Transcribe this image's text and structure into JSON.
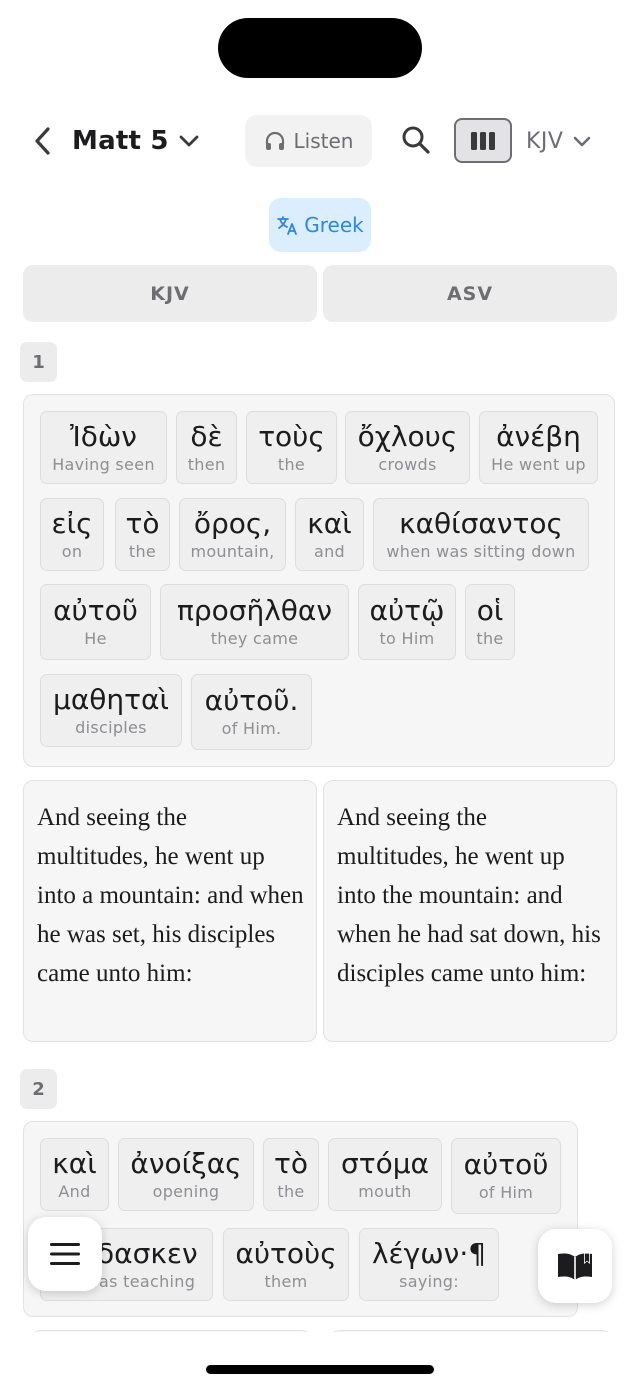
{
  "header": {
    "book_chapter": "Matt 5",
    "listen_label": "Listen",
    "version": "KJV",
    "icons": [
      "chevron-left-icon",
      "chevron-down-icon",
      "headphones-icon",
      "search-icon",
      "columns-icon"
    ]
  },
  "language_toggle": {
    "label": "Greek",
    "icon": "translate-icon",
    "accent": "#2e86de"
  },
  "version_tabs": [
    "KJV",
    "ASV"
  ],
  "verses": [
    {
      "number": "1",
      "words": [
        {
          "greek": "Ἰδὼν",
          "english": "Having seen"
        },
        {
          "greek": "δὲ",
          "english": "then"
        },
        {
          "greek": "τοὺς",
          "english": "the"
        },
        {
          "greek": "ὄχλους",
          "english": "crowds"
        },
        {
          "greek": "ἀνέβη",
          "english": "He went up"
        },
        {
          "greek": "εἰς",
          "english": "on"
        },
        {
          "greek": "τὸ",
          "english": "the"
        },
        {
          "greek": "ὄρος,",
          "english": "mountain,"
        },
        {
          "greek": "καὶ",
          "english": "and"
        },
        {
          "greek": "καθίσαντος",
          "english": "when was sitting down"
        },
        {
          "greek": "αὐτοῦ",
          "english": "He"
        },
        {
          "greek": "προσῆλθαν",
          "english": "they came"
        },
        {
          "greek": "αὐτῷ",
          "english": "to Him"
        },
        {
          "greek": "οἱ",
          "english": "the"
        },
        {
          "greek": "μαθηταὶ",
          "english": "disciples"
        },
        {
          "greek": "αὐτοῦ.",
          "english": "of Him."
        }
      ],
      "translations": [
        "And seeing the multitudes, he went up into a mountain: and when he was set, his disciples came unto him:",
        "And seeing the multitudes, he went up into the mountain: and when he had sat down, his disciples came unto him:"
      ]
    },
    {
      "number": "2",
      "words": [
        {
          "greek": "καὶ",
          "english": "And"
        },
        {
          "greek": "ἀνοίξας",
          "english": "opening"
        },
        {
          "greek": "τὸ",
          "english": "the"
        },
        {
          "greek": "στόμα",
          "english": "mouth"
        },
        {
          "greek": "αὐτοῦ",
          "english": "of Him"
        },
        {
          "greek": "ἐδίδασκεν",
          "english": "He was teaching"
        },
        {
          "greek": "αὐτοὺς",
          "english": "them"
        },
        {
          "greek": "λέγων·¶",
          "english": "saying:"
        }
      ]
    }
  ],
  "fabs": {
    "menu_icon": "hamburger-menu-icon",
    "book_icon": "open-book-icon"
  }
}
